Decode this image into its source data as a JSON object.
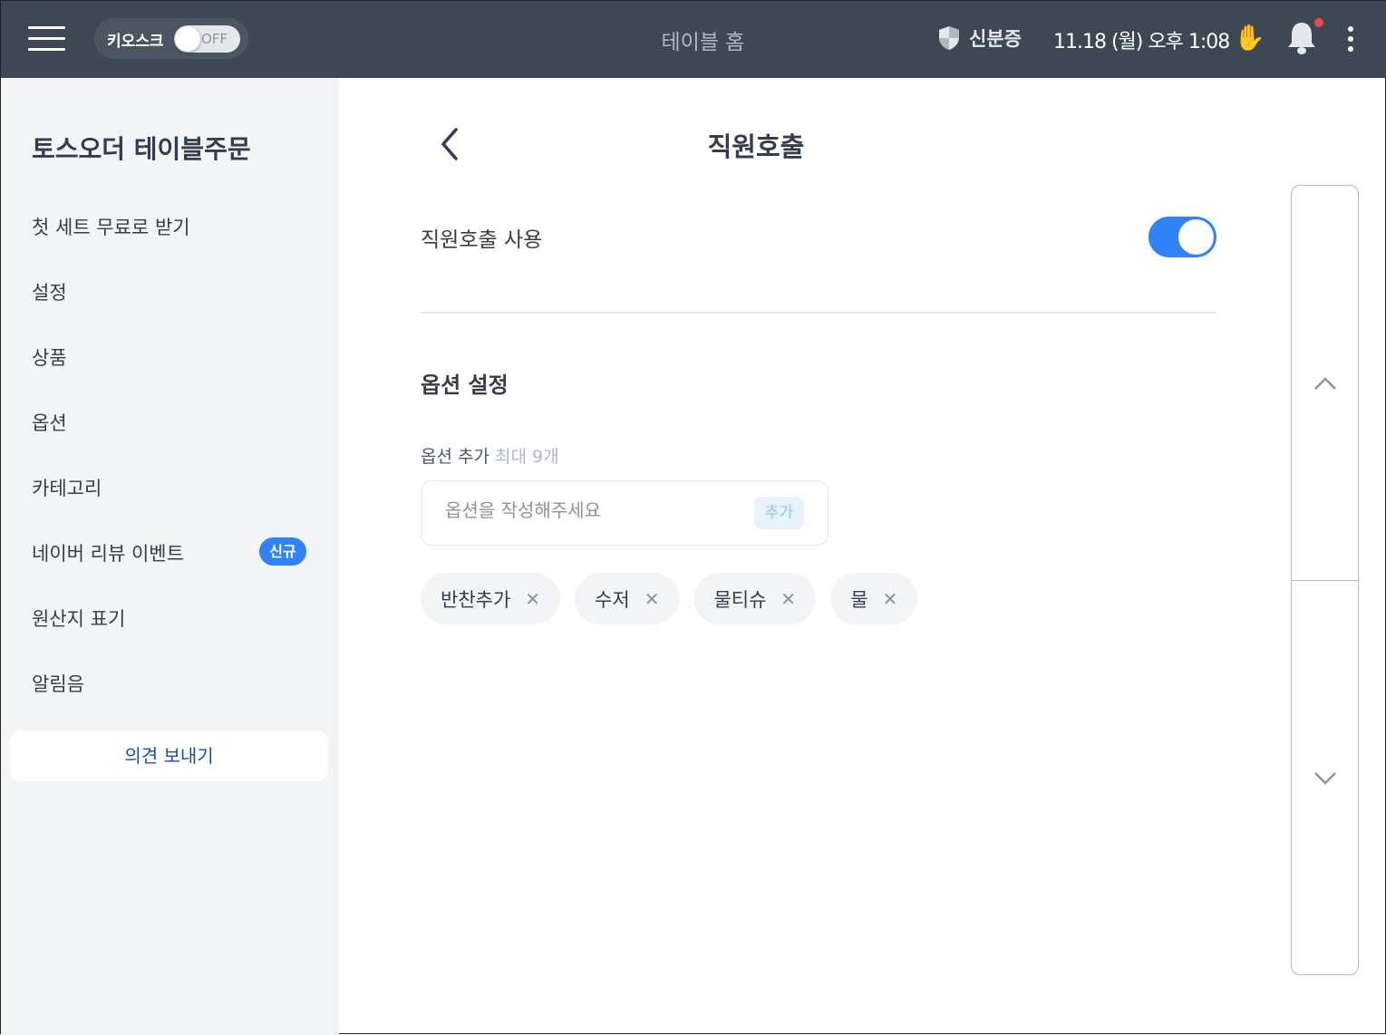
{
  "header": {
    "title": "테이블 홈",
    "kiosk_label": "키오스크",
    "kiosk_state": "OFF",
    "id_card": "신분증",
    "datetime": "11.18 (월) 오후 1:08",
    "notification_dot": true
  },
  "sidebar": {
    "brand": "토스오더 테이블주문",
    "items": [
      {
        "label": "첫 세트 무료로 받기"
      },
      {
        "label": "설정"
      },
      {
        "label": "상품"
      },
      {
        "label": "옵션"
      },
      {
        "label": "카테고리"
      },
      {
        "label": "네이버 리뷰 이벤트",
        "badge": "신규"
      },
      {
        "label": "원산지 표기"
      },
      {
        "label": "알림음"
      }
    ],
    "feedback": "의견 보내기"
  },
  "main": {
    "title": "직원호출",
    "use_label": "직원호출 사용",
    "use_enabled": true,
    "section_title": "옵션 설정",
    "add_label": "옵션 추가",
    "add_hint": "최대 9개",
    "input_placeholder": "옵션을 작성해주세요",
    "input_value": "",
    "add_button": "추가",
    "options": [
      "반찬추가",
      "수저",
      "물티슈",
      "물"
    ]
  },
  "colors": {
    "header_bg": "#3e4854",
    "accent": "#3182f6",
    "sidebar_bg": "#f2f4f6"
  }
}
